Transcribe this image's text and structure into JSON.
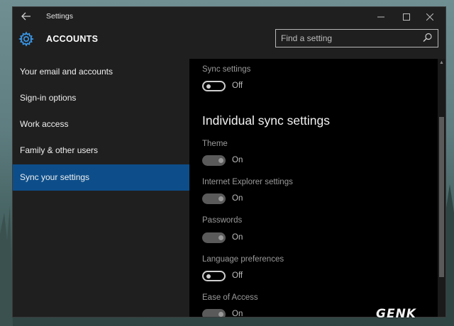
{
  "window": {
    "title": "Settings",
    "buttons": {
      "minimize": "—",
      "maximize": "☐",
      "close": "✕"
    }
  },
  "header": {
    "section_title": "ACCOUNTS",
    "search_placeholder": "Find a setting"
  },
  "sidebar": {
    "items": [
      {
        "label": "Your email and accounts",
        "active": false
      },
      {
        "label": "Sign-in options",
        "active": false
      },
      {
        "label": "Work access",
        "active": false
      },
      {
        "label": "Family & other users",
        "active": false
      },
      {
        "label": "Sync your settings",
        "active": true
      }
    ]
  },
  "content": {
    "sync_settings": {
      "label": "Sync settings",
      "state": "Off"
    },
    "individual_heading": "Individual sync settings",
    "items": [
      {
        "label": "Theme",
        "state": "On"
      },
      {
        "label": "Internet Explorer settings",
        "state": "On"
      },
      {
        "label": "Passwords",
        "state": "On"
      },
      {
        "label": "Language preferences",
        "state": "Off"
      },
      {
        "label": "Ease of Access",
        "state": "On"
      }
    ]
  },
  "watermark": "GENK",
  "colors": {
    "accent": "#0d4e8a",
    "panel": "#1f1f1f",
    "content": "#000000"
  }
}
